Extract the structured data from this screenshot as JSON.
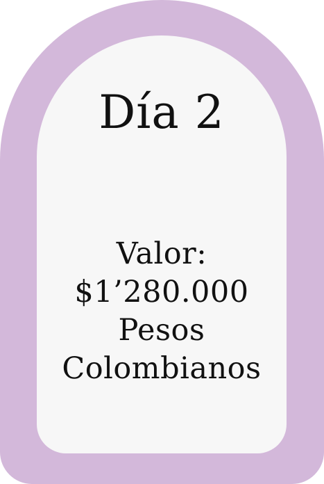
{
  "card": {
    "day_label": "Día 2",
    "price_lines": [
      "Valor:",
      "$1’280.000",
      "Pesos",
      "Colombianos"
    ]
  },
  "colors": {
    "outer_frame": "#d3b8da",
    "inner_panel": "#f7f7f7",
    "text": "#111111"
  }
}
